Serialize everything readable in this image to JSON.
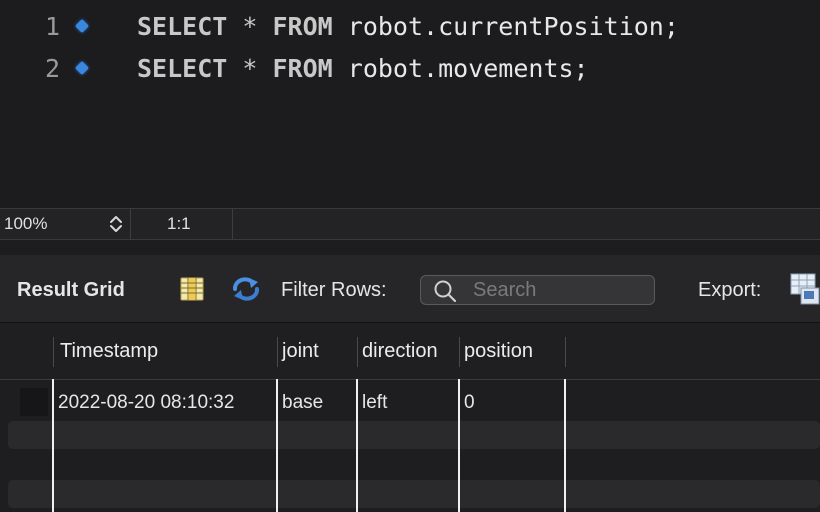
{
  "editor": {
    "lines": [
      {
        "num": "1",
        "keyword1": "SELECT",
        "op": "*",
        "keyword2": "FROM",
        "target": "robot.currentPosition;"
      },
      {
        "num": "2",
        "keyword1": "SELECT",
        "op": "*",
        "keyword2": "FROM",
        "target": "robot.movements;"
      }
    ]
  },
  "statusbar": {
    "zoom": "100%",
    "cursor": "1:1"
  },
  "toolbar": {
    "result_grid_label": "Result Grid",
    "filter_rows_label": "Filter Rows:",
    "search_placeholder": "Search",
    "export_label": "Export:"
  },
  "grid": {
    "columns": [
      "Timestamp",
      "joint",
      "direction",
      "position"
    ],
    "rows": [
      [
        "2022-08-20 08:10:32",
        "base",
        "left",
        "0"
      ]
    ]
  },
  "colors": {
    "breakpoint": "#3a87de",
    "background": "#1c1c1e",
    "accent_blue": "#4a90e2"
  }
}
